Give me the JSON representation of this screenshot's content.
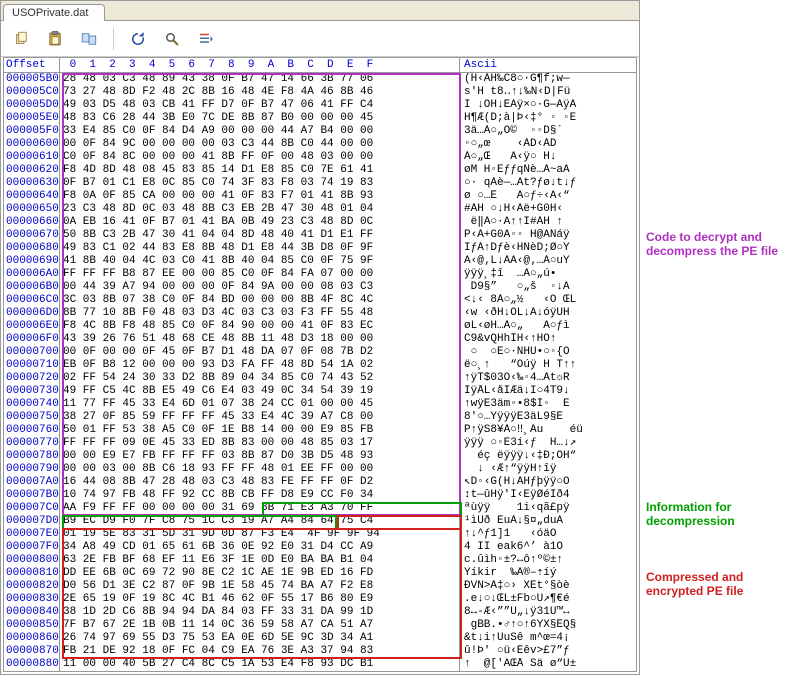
{
  "tab": {
    "label": "USOPrivate.dat"
  },
  "header": {
    "offset": "Offset",
    "hex": " 0  1  2  3  4  5  6  7  8  9  A  B  C  D  E  F",
    "ascii": "Ascii"
  },
  "labels": {
    "purple": "Code to decrypt and decompress the PE file",
    "green": "Information for decompression",
    "red": "Compressed and encrypted PE file"
  },
  "rows": [
    {
      "off": "000005B0",
      "hex": "28 48 03 C3 48 89 43 38 0F B7 47 14 66 3B 77 06",
      "asc": "(H‹ÃH‰C8○·G¶f;w—"
    },
    {
      "off": "000005C0",
      "hex": "73 27 48 8D F2 48 2C 8B 16 48 4E F8 4A 46 8B 46",
      "asc": "s'H t8‥↑↓‰N‹D|Fü"
    },
    {
      "off": "000005D0",
      "hex": "49 03 D5 48 03 CB 41 FF D7 0F B7 47 06 41 FF C4",
      "asc": "I ↓ÕH↓ËAÿ×○·G—AÿÄ"
    },
    {
      "off": "000005E0",
      "hex": "48 83 C6 28 44 3B E0 7C DE 8B 87 B0 00 00 00 45",
      "asc": "H¶Æ(D;à|Þ‹‡° ◦ ◦E"
    },
    {
      "off": "000005F0",
      "hex": "33 E4 85 C0 0F 84 D4 A9 00 00 00 44 A7 B4 00 00",
      "asc": "3ä…À○„Ô©  ◦◦D§´"
    },
    {
      "off": "00000600",
      "hex": "00 0F 84 9C 00 00 00 00 03 C3 44 8B C0 44 00 00",
      "asc": "◦○„œ    ‹ÃD‹ÀD"
    },
    {
      "off": "00000610",
      "hex": "C0 0F 84 8C 00 00 00 41 8B FF 0F 00 48 03 00 00",
      "asc": "À○„Œ   A‹ÿ○ H↓"
    },
    {
      "off": "00000620",
      "hex": "F8 4D 8D 48 08 45 83 85 14 D1 E8 85 C0 7E 61 41",
      "asc": "øM H◦EƒƒqÑè…À~aA"
    },
    {
      "off": "00000630",
      "hex": "0F B7 01 C1 E8 0C 85 C0 74 3F 83 F8 03 74 19 83",
      "asc": "○· qÀè—…Àt?ƒø↓t↓ƒ"
    },
    {
      "off": "00000640",
      "hex": "F8 0A 0F 85 CA 00 00 00 41 0F 83 F7 01 41 8B 93",
      "asc": "ø ○…Ê   A○ƒ÷‹A‹“"
    },
    {
      "off": "00000650",
      "hex": "23 C3 48 8D 0C 03 48 8B C3 EB 2B 47 30 48 01 04",
      "asc": "#ÃH ○↓H‹Ãë+G0H‹"
    },
    {
      "off": "00000660",
      "hex": "0A EB 16 41 0F B7 01 41 BA 0B 49 23 C3 48 8D 0C",
      "asc": " ë‖A○·A↑↑I#ÃH ↑"
    },
    {
      "off": "00000670",
      "hex": "50 8B C3 2B 47 30 41 04 04 8D 48 40 41 D1 E1 FF",
      "asc": "P‹Ã+G0A◦◦ H@AÑáÿ"
    },
    {
      "off": "00000680",
      "hex": "49 83 C1 02 44 83 E8 8B 48 D1 E8 44 3B D8 0F 9F",
      "asc": "IƒÁ↑Dƒè‹HÑèD;Ø○Ÿ"
    },
    {
      "off": "00000690",
      "hex": "41 8B 40 04 4C 03 C0 41 8B 40 04 85 C0 0F 75 9F",
      "asc": "A‹@‚L↓ÀA‹@‚…À○uŸ"
    },
    {
      "off": "000006A0",
      "hex": "FF FF FF B8 87 EE 00 00 85 C0 0F 84 FA 07 00 00",
      "asc": "ÿÿÿ¸‡î  …À○„ú•"
    },
    {
      "off": "000006B0",
      "hex": "00 44 39 A7 94 00 00 00 0F 84 9A 00 00 08 03 C3",
      "asc": " D9§”   ○„š  ◦↓Ã"
    },
    {
      "off": "000006C0",
      "hex": "3C 03 8B 07 38 C0 0F 84 BD 00 00 00 8B 4F 8C 4C",
      "asc": "<↓‹ 8À○„½   ‹O ŒL"
    },
    {
      "off": "000006D0",
      "hex": "8B 77 10 8B F0 48 03 D3 4C 03 C3 03 F3 FF 55 48",
      "asc": "‹w ‹ðH↓ÓL↓Ã↓óÿUH"
    },
    {
      "off": "000006E0",
      "hex": "F8 4C 8B F8 48 85 C0 0F 84 90 00 00 41 0F 83 EC",
      "asc": "øL‹øH…À○„   A○ƒì"
    },
    {
      "off": "000006F0",
      "hex": "43 39 26 76 51 48 68 CE 48 8B 11 48 D3 18 00 00",
      "asc": "C9&vQHhÎH‹↑HÓ↑"
    },
    {
      "off": "00000700",
      "hex": "00 0F 00 00 0F 45 0F B7 D1 48 DA 07 0F 08 7B D2",
      "asc": " ○  ○E○·ÑHÚ•○◦{Ò"
    },
    {
      "off": "00000710",
      "hex": "EB 0F B8 12 00 00 00 93 D3 FA FF 48 8D 54 1A 02",
      "asc": "ë○¸↑   “Óúÿ H T↑↑"
    },
    {
      "off": "00000720",
      "hex": "02 FF 54 24 30 33 D2 8B 89 04 34 85 C0 74 43 52",
      "asc": "↑ÿT$03Ò‹‰◦4…Àt☼R"
    },
    {
      "off": "00000730",
      "hex": "49 FF C5 4C 8B E5 49 C6 E4 03 49 0C 34 54 39 19",
      "asc": "IÿÅL‹åIÆä↓I○4T9↓"
    },
    {
      "off": "00000740",
      "hex": "11 77 FF 45 33 E4 6D 01 07 38 24 CC 01 00 00 45",
      "asc": "↑wÿE3äm◦•8$Ì◦  E"
    },
    {
      "off": "00000750",
      "hex": "38 27 0F 85 59 FF FF FF 45 33 E4 4C 39 A7 C8 00",
      "asc": "8'○…YÿÿÿE3äL9§È"
    },
    {
      "off": "00000760",
      "hex": "50 01 FF 53 38 A5 C0 0F 1E B8 14 00 00 E9 85 FB",
      "asc": "P↑ÿS8¥À○‼¸Au    éü"
    },
    {
      "off": "00000770",
      "hex": "FF FF FF 09 0E 45 33 ED 8B 83 00 00 48 85 03 17",
      "asc": "ÿÿÿ ○◦E3í‹ƒ  H…↓↗"
    },
    {
      "off": "00000780",
      "hex": "00 00 E9 E7 FB FF FF FF 03 8B 87 D0 3B D5 48 93",
      "asc": "  éç ëÿÿÿ↓‹‡Ð;ÕH“"
    },
    {
      "off": "00000790",
      "hex": "00 00 03 00 8B C6 18 93 FF FF 48 01 EE FF 00 00",
      "asc": "  ↓ ‹Æ↑“ÿÿH↑îÿ"
    },
    {
      "off": "000007A0",
      "hex": "16 44 08 8B 47 28 48 03 C3 48 83 FE FF FF 0F D2",
      "asc": "↖D◦‹G(H↓ÃHƒþÿÿ○Ò"
    },
    {
      "off": "000007B0",
      "hex": "10 74 97 FB 48 FF 92 CC 8B CB FF D8 E9 CC F0 34",
      "asc": "↕t—ûHÿ'Ì‹ËÿØéÌð4"
    },
    {
      "off": "000007C0",
      "hex": "AA F9 FF FF 00 00 00 00 31 69 8B 71 E3 A3 70 FF",
      "asc": "ªùÿÿ    1i‹qã£pÿ"
    },
    {
      "off": "000007D0",
      "hex": "B9 EC D9 F0 7F C8 75 1C C3 19 A7 A4 84 64 75 C4",
      "asc": "¹ìÙð ÈuÃ↓§¤„duÄ"
    },
    {
      "off": "000007E0",
      "hex": "01 19 5E 83 31 5D 31 9D 0D 87 F3 E4  4F 9F 9F 94",
      "asc": "↑↓^ƒ1]1   ‹óäO "
    },
    {
      "off": "000007F0",
      "hex": "34 A8 49 CD 01 65 61 6B 36 0E 92 E0 31 D4 CC A9",
      "asc": "4 II eak6^’ à1Ô"
    },
    {
      "off": "00000800",
      "hex": "63 2E FB BF 68 EF 11 E6 3F 1E 0D E0 BA BA B1 04",
      "asc": "c.ûìh­◦±?↔ô↑º©±↑"
    },
    {
      "off": "00000810",
      "hex": "DD EE 6B 0C 69 72 90 8E C2 1C AE 1E 9B ED 16 FD",
      "asc": "Ýíkir  ‰Â®‒⇡íý"
    },
    {
      "off": "00000820",
      "hex": "D0 56 D1 3E C2 87 0F 9B 1E 58 45 74 BA A7 F2 E8",
      "asc": "ÐVÑ>Â‡○› XEt°§òè"
    },
    {
      "off": "00000830",
      "hex": "2E 65 19 0F 19 8C 4C B1 46 62 0F 55 17 B6 80 E9",
      "asc": ".e↓○↓ŒL±Fb○U↗¶€é"
    },
    {
      "off": "00000840",
      "hex": "38 1D 2D C6 8B 94 94 DA 84 03 FF 33 31 DA 99 1D",
      "asc": "8↔-Æ‹””Ú„↓ÿ31Ú™↔"
    },
    {
      "off": "00000850",
      "hex": "7F B7 67 2E 1B 0B 11 14 0C 36 59 58 A7 CA 51 A7",
      "asc": " gBB.•♂↑○↑6YX§ÊQ§"
    },
    {
      "off": "00000860",
      "hex": "26 74 97 69 55 D3 75 53 EA 0E 6D 5E 9C 3D 34 A1",
      "asc": "&t↓i↑ÚuSê m^œ=4¡"
    },
    {
      "off": "00000870",
      "hex": "FB 21 DE 92 18 0F FC 04 C9 EA 76 3E A3 37 94 83",
      "asc": "û!Þ' ○ü‹Éêv>£7”ƒ"
    },
    {
      "off": "00000880",
      "hex": "11 00 00 40 5B 27 C4 8C C5 1A 53 E4 F8 93 DC B1",
      "asc": "↑  @['ÄŒÅ Sä ø“Ü±"
    }
  ]
}
